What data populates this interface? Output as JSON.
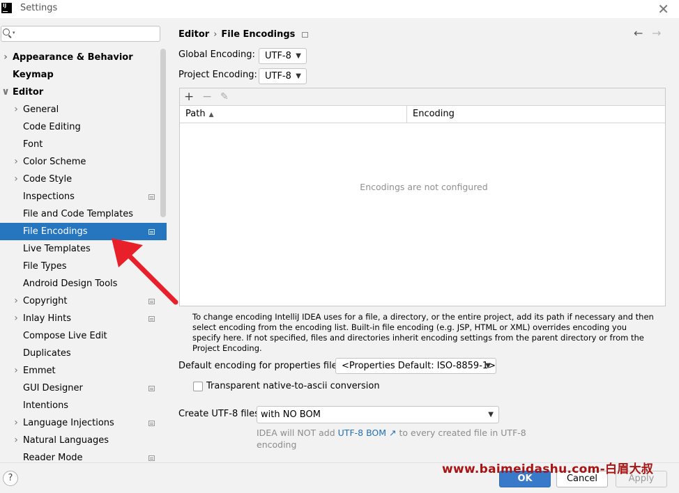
{
  "window": {
    "logo": "IJ",
    "title": "Settings",
    "close_glyph": "✕"
  },
  "sidebar": {
    "search": {
      "value": "",
      "placeholder": ""
    },
    "items": [
      {
        "label": "Appearance & Behavior",
        "level": 0,
        "expandable": true,
        "project": false,
        "selected": false
      },
      {
        "label": "Keymap",
        "level": 0,
        "expandable": false,
        "project": false,
        "selected": false
      },
      {
        "label": "Editor",
        "level": 0,
        "expandable": true,
        "expanded": true,
        "project": false,
        "selected": false
      },
      {
        "label": "General",
        "level": 1,
        "expandable": true,
        "project": false,
        "selected": false
      },
      {
        "label": "Code Editing",
        "level": 1,
        "expandable": false,
        "project": false,
        "selected": false
      },
      {
        "label": "Font",
        "level": 1,
        "expandable": false,
        "project": false,
        "selected": false
      },
      {
        "label": "Color Scheme",
        "level": 1,
        "expandable": true,
        "project": false,
        "selected": false
      },
      {
        "label": "Code Style",
        "level": 1,
        "expandable": true,
        "project": false,
        "selected": false
      },
      {
        "label": "Inspections",
        "level": 1,
        "expandable": false,
        "project": true,
        "selected": false
      },
      {
        "label": "File and Code Templates",
        "level": 1,
        "expandable": false,
        "project": false,
        "selected": false
      },
      {
        "label": "File Encodings",
        "level": 1,
        "expandable": false,
        "project": true,
        "selected": true
      },
      {
        "label": "Live Templates",
        "level": 1,
        "expandable": false,
        "project": false,
        "selected": false
      },
      {
        "label": "File Types",
        "level": 1,
        "expandable": false,
        "project": false,
        "selected": false
      },
      {
        "label": "Android Design Tools",
        "level": 1,
        "expandable": false,
        "project": false,
        "selected": false
      },
      {
        "label": "Copyright",
        "level": 1,
        "expandable": true,
        "project": true,
        "selected": false
      },
      {
        "label": "Inlay Hints",
        "level": 1,
        "expandable": true,
        "project": true,
        "selected": false
      },
      {
        "label": "Compose Live Edit",
        "level": 1,
        "expandable": false,
        "project": false,
        "selected": false
      },
      {
        "label": "Duplicates",
        "level": 1,
        "expandable": false,
        "project": false,
        "selected": false
      },
      {
        "label": "Emmet",
        "level": 1,
        "expandable": true,
        "project": false,
        "selected": false
      },
      {
        "label": "GUI Designer",
        "level": 1,
        "expandable": false,
        "project": true,
        "selected": false
      },
      {
        "label": "Intentions",
        "level": 1,
        "expandable": false,
        "project": false,
        "selected": false
      },
      {
        "label": "Language Injections",
        "level": 1,
        "expandable": true,
        "project": true,
        "selected": false
      },
      {
        "label": "Natural Languages",
        "level": 1,
        "expandable": true,
        "project": false,
        "selected": false
      },
      {
        "label": "Reader Mode",
        "level": 1,
        "expandable": false,
        "project": true,
        "selected": false
      }
    ]
  },
  "main": {
    "breadcrumb": {
      "parent": "Editor",
      "separator": "›",
      "current": "File Encodings"
    },
    "global_encoding": {
      "label": "Global Encoding:",
      "value": "UTF-8"
    },
    "project_encoding": {
      "label": "Project Encoding:",
      "value": "UTF-8"
    },
    "table": {
      "toolbar": {
        "add": "+",
        "remove": "−",
        "edit": "✎"
      },
      "columns": {
        "path": "Path",
        "encoding": "Encoding"
      },
      "empty_text": "Encodings are not configured"
    },
    "help_text": "To change encoding IntelliJ IDEA uses for a file, a directory, or the entire project, add its path if necessary and then select encoding from the encoding list. Built-in file encoding (e.g. JSP, HTML or XML) overrides encoding you specify here. If not specified, files and directories inherit encoding settings from the parent directory or from the Project Encoding.",
    "properties_encoding": {
      "label": "Default encoding for properties files:",
      "value": "<Properties Default: ISO-8859-1>"
    },
    "transparent_conversion": {
      "label": "Transparent native-to-ascii conversion",
      "checked": false
    },
    "utf8_files": {
      "label": "Create UTF-8 files:",
      "value": "with NO BOM"
    },
    "bom_hint": {
      "before": "IDEA will NOT add ",
      "link": "UTF-8 BOM",
      "link_icon": "↗",
      "after": " to every created file in UTF-8 encoding"
    }
  },
  "footer": {
    "help": "?",
    "ok": "OK",
    "cancel": "Cancel",
    "apply": "Apply"
  },
  "watermark": "www.baimeidashu.com-白眉大叔",
  "colors": {
    "selection": "#2675bf",
    "ok_button": "#3879c9",
    "link": "#2470b3",
    "annotation_arrow": "#e8202a",
    "watermark": "#a81414"
  }
}
